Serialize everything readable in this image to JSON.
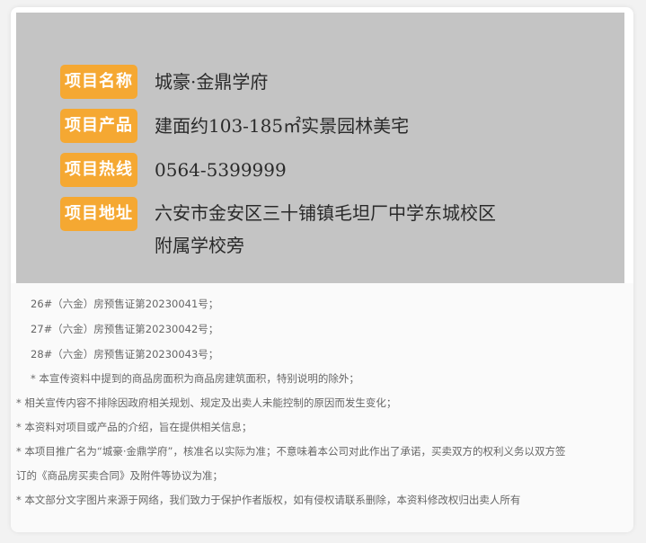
{
  "project": {
    "name_label": "项目名称",
    "name_value": "城豪·金鼎学府",
    "product_label": "项目产品",
    "product_value": "建面约103-185㎡实景园林美宅",
    "hotline_label": "项目热线",
    "hotline_value": "0564-5399999",
    "address_label": "项目地址",
    "address_line1": "六安市金安区三十铺镇毛坦厂中学东城校区",
    "address_line2": "附属学校旁"
  },
  "notes": [
    "26#（六金）房预售证第20230041号；",
    "27#（六金）房预售证第20230042号；",
    "28#（六金）房预售证第20230043号；",
    "* 本宣传资料中提到的商品房面积为商品房建筑面积，特别说明的除外；",
    "* 相关宣传内容不排除因政府相关规划、规定及出卖人未能控制的原因而发生变化；",
    "* 本资料对项目或产品的介绍，旨在提供相关信息；",
    "* 本项目推广名为“城豪·金鼎学府”，核准名以实际为准；不意味着本公司对此作出了承诺，买卖双方的权利义务以双方签",
    "订的《商品房买卖合同》及附件等协议为准；",
    "* 本文部分文字图片来源于网络，我们致力于保护作者版权，如有侵权请联系删除，本资料修改权归出卖人所有"
  ]
}
